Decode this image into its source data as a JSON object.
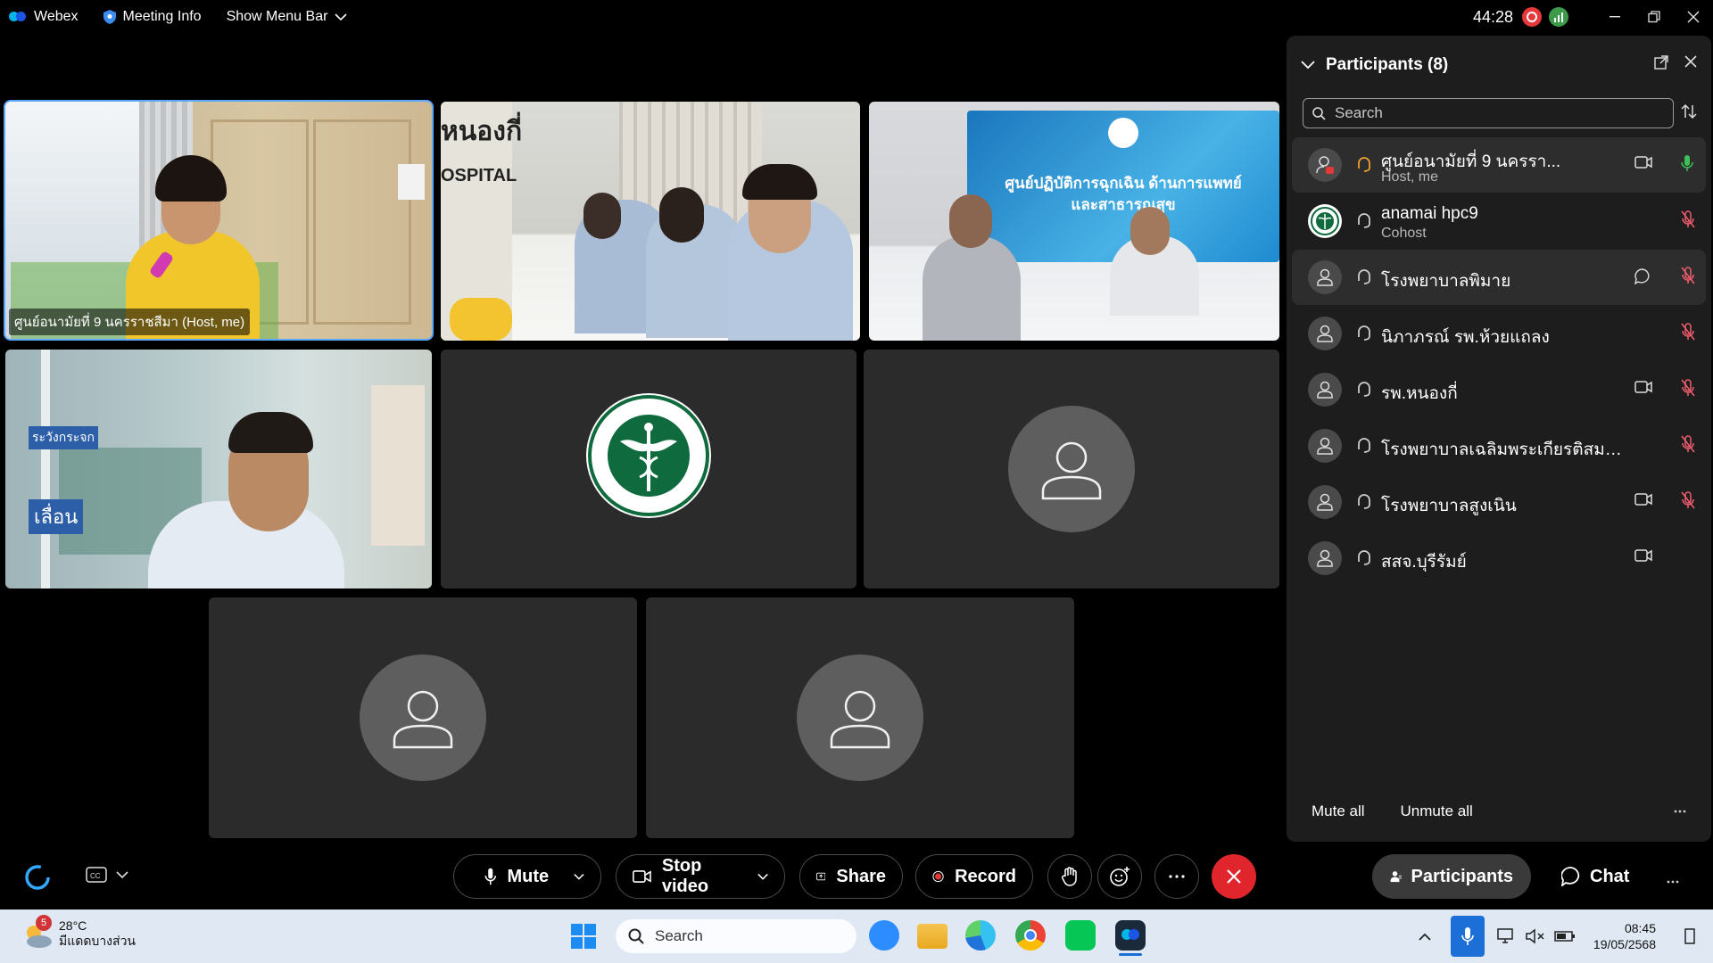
{
  "titlebar": {
    "app_name": "Webex",
    "meeting_info": "Meeting Info",
    "show_menu_bar": "Show Menu Bar",
    "timer": "44:28"
  },
  "video_tiles": [
    {
      "label": "ศูนย์อนามัยที่ 9 นครราชสีมา (Host, me)",
      "kind": "video",
      "active": true
    },
    {
      "label": "",
      "kind": "video",
      "sign_text_1": "หนองกี่",
      "sign_text_2": "OSPITAL"
    },
    {
      "label": "",
      "kind": "video",
      "banner_text": "ศูนย์ปฏิบัติการฉุกเฉิน ด้านการแพทย์และสาธารณสุข"
    },
    {
      "label": "",
      "kind": "video",
      "sign_text_1": "ระวังกระจก",
      "sign_text_2": "เลื่อน"
    },
    {
      "label": "",
      "kind": "logo",
      "logo_text": "MINISTRY OF PUBLIC HEALTH"
    },
    {
      "label": "",
      "kind": "avatar"
    },
    {
      "label": "",
      "kind": "avatar"
    },
    {
      "label": "",
      "kind": "avatar"
    }
  ],
  "participants_panel": {
    "title": "Participants (8)",
    "search_placeholder": "Search",
    "participants": [
      {
        "name": "ศูนย์อนามัยที่ 9 นครรา...",
        "role": "Host, me",
        "video": true,
        "mic": "on",
        "highlighted": true
      },
      {
        "name": "anamai hpc9",
        "role": "Cohost",
        "video": false,
        "mic": "muted",
        "highlighted": false
      },
      {
        "name": "โรงพยาบาลพิมาย",
        "role": "",
        "video": false,
        "chat": true,
        "mic": "muted",
        "highlighted": true
      },
      {
        "name": "นิภาภรณ์ รพ.ห้วยแถลง",
        "role": "",
        "video": false,
        "mic": "muted",
        "highlighted": false
      },
      {
        "name": "รพ.หนองกี่",
        "role": "",
        "video": true,
        "mic": "muted",
        "highlighted": false
      },
      {
        "name": "โรงพยาบาลเฉลิมพระเกียรติสมเด็จ...",
        "role": "",
        "video": false,
        "mic": "muted",
        "highlighted": false
      },
      {
        "name": "โรงพยาบาลสูงเนิน",
        "role": "",
        "video": true,
        "mic": "muted",
        "highlighted": false
      },
      {
        "name": "สสจ.บุรีรัมย์",
        "role": "",
        "video": true,
        "mic": "none",
        "highlighted": false
      }
    ],
    "mute_all": "Mute all",
    "unmute_all": "Unmute all"
  },
  "controls": {
    "mute": "Mute",
    "stop_video": "Stop video",
    "share": "Share",
    "record": "Record",
    "participants": "Participants",
    "chat": "Chat"
  },
  "taskbar": {
    "weather_badge": "5",
    "temperature": "28°C",
    "weather_text": "มีแดดบางส่วน",
    "search_placeholder": "Search",
    "time": "08:45",
    "date": "19/05/2568",
    "apps": [
      "start-icon",
      "zoom-icon",
      "file-explorer-icon",
      "edge-icon",
      "chrome-icon",
      "line-icon",
      "webex-icon"
    ]
  },
  "colors": {
    "accent_blue": "#5aa7ff",
    "end_call_red": "#e0262c",
    "record_red": "#e5383b",
    "mic_on_green": "#3fbf5a",
    "muted_red": "#f25c6e",
    "panel_bg": "#1d1d1d",
    "tile_bg": "#2b2b2b"
  }
}
